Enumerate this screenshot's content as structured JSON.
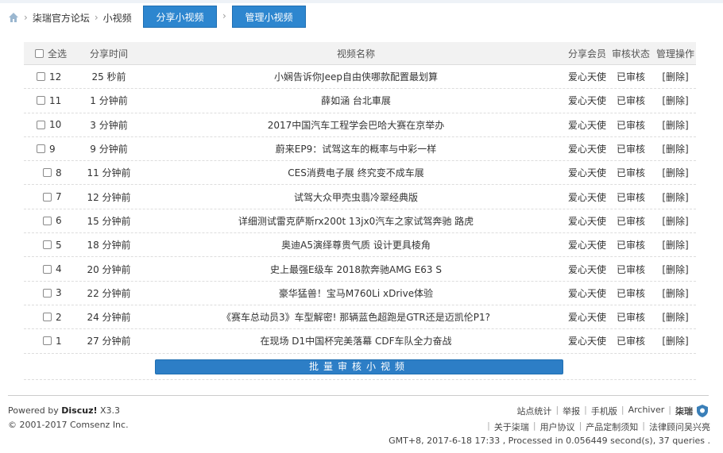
{
  "breadcrumb": {
    "home_icon": "home-icon",
    "separator": "›",
    "forum": "柒瑞官方论坛",
    "section": "小视频"
  },
  "tabs": [
    {
      "label": "分享小视频"
    },
    {
      "label": "管理小视频"
    }
  ],
  "table": {
    "headers": {
      "select_all": "全选",
      "time": "分享时间",
      "name": "视频名称",
      "member": "分享会员",
      "status": "审核状态",
      "ops": "管理操作"
    },
    "rows": [
      {
        "id": "12",
        "time": "25 秒前",
        "name": "小娴告诉你Jeep自由侠哪款配置最划算",
        "member": "爱心天使",
        "status": "已审核",
        "op": "[删除]"
      },
      {
        "id": "11",
        "time": "1 分钟前",
        "name": "薛如涵 台北車展",
        "member": "爱心天使",
        "status": "已审核",
        "op": "[删除]"
      },
      {
        "id": "10",
        "time": "3 分钟前",
        "name": "2017中国汽车工程学会巴哈大赛在京举办",
        "member": "爱心天使",
        "status": "已审核",
        "op": "[删除]"
      },
      {
        "id": "9",
        "time": "9 分钟前",
        "name": "蔚来EP9：试驾这车的概率与中彩一样",
        "member": "爱心天使",
        "status": "已审核",
        "op": "[删除]"
      },
      {
        "id": "8",
        "time": "11 分钟前",
        "name": "CES消费电子展 终究变不成车展",
        "member": "爱心天使",
        "status": "已审核",
        "op": "[删除]"
      },
      {
        "id": "7",
        "time": "12 分钟前",
        "name": "试驾大众甲壳虫翡冷翠经典版",
        "member": "爱心天使",
        "status": "已审核",
        "op": "[删除]"
      },
      {
        "id": "6",
        "time": "15 分钟前",
        "name": "详细测试雷克萨斯rx200t 13jx0汽车之家试驾奔驰 路虎",
        "member": "爱心天使",
        "status": "已审核",
        "op": "[删除]"
      },
      {
        "id": "5",
        "time": "18 分钟前",
        "name": "奥迪A5演绎尊贵气质 设计更具棱角",
        "member": "爱心天使",
        "status": "已审核",
        "op": "[删除]"
      },
      {
        "id": "4",
        "time": "20 分钟前",
        "name": "史上最强E级车 2018款奔驰AMG E63 S",
        "member": "爱心天使",
        "status": "已审核",
        "op": "[删除]"
      },
      {
        "id": "3",
        "time": "22 分钟前",
        "name": "豪华猛兽！宝马M760Li xDrive体验",
        "member": "爱心天使",
        "status": "已审核",
        "op": "[删除]"
      },
      {
        "id": "2",
        "time": "24 分钟前",
        "name": "《赛车总动员3》车型解密! 那辆蓝色超跑是GTR还是迈凯伦P1?",
        "member": "爱心天使",
        "status": "已审核",
        "op": "[删除]"
      },
      {
        "id": "1",
        "time": "27 分钟前",
        "name": "在现场 D1中国杯完美落幕 CDF车队全力奋战",
        "member": "爱心天使",
        "status": "已审核",
        "op": "[删除]"
      }
    ]
  },
  "batch_button": "批量审核小视频",
  "footer": {
    "powered_prefix": "Powered by ",
    "powered_brand": "Discuz!",
    "powered_version": " X3.3",
    "copyright": "© 2001-2017 Comsenz Inc.",
    "links1": [
      "站点统计",
      "举报",
      "手机版",
      "Archiver",
      "柒瑞"
    ],
    "links2": [
      "关于柒瑞",
      "用户协议",
      "产品定制须知",
      "法律顾问吴兴亮"
    ],
    "debug": "GMT+8, 2017-6-18 17:33 , Processed in 0.056449 second(s), 37 queries ."
  },
  "colors": {
    "tab_bg": "#2d86cf",
    "batch_bg": "#2d7ec6",
    "header_bg": "#f2f2f2"
  }
}
